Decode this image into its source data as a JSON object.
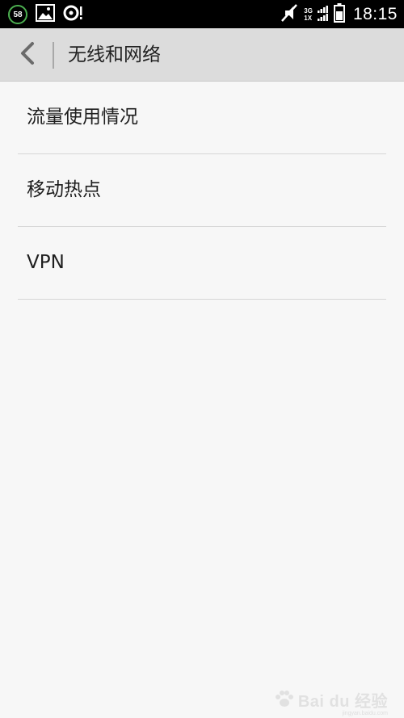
{
  "status_bar": {
    "badge_count": "58",
    "net_top": "3G",
    "net_bottom": "1X",
    "time": "18:15",
    "icons": [
      "image-icon",
      "sync-alert-icon",
      "mute-icon",
      "signal-icon",
      "battery-icon"
    ]
  },
  "header": {
    "title": "无线和网络",
    "back_icon": "chevron-left-icon"
  },
  "list": {
    "items": [
      {
        "label": "流量使用情况"
      },
      {
        "label": "移动热点"
      },
      {
        "label": "VPN"
      }
    ]
  },
  "watermark": {
    "main": "Bai du 经验",
    "sub": "jingyan.baidu.com"
  },
  "colors": {
    "status_bar_bg": "#000000",
    "action_bar_bg": "#dcdcdc",
    "page_bg": "#f7f7f7",
    "divider": "#d6d6d6",
    "badge_ring": "#4caf50"
  }
}
